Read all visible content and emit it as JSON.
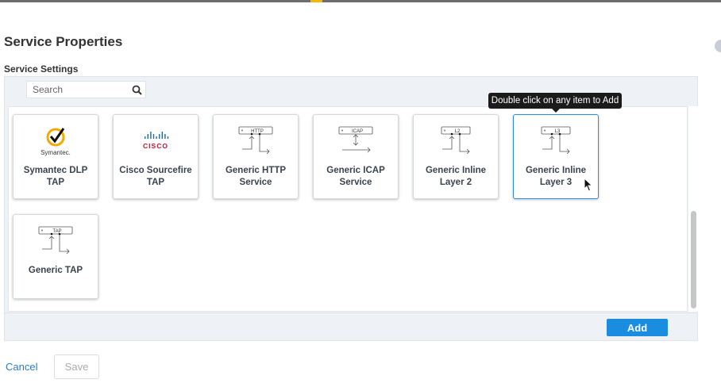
{
  "page": {
    "title": "Service Properties",
    "section": "Service Settings"
  },
  "search": {
    "placeholder": "Search"
  },
  "tooltip": "Double click on any item to Add",
  "items": [
    {
      "label1": "Symantec DLP",
      "label2": "TAP",
      "icon": "symantec-logo",
      "logo_text": "Symantec."
    },
    {
      "label1": "Cisco Sourcefire",
      "label2": "TAP",
      "icon": "cisco-logo",
      "logo_text": "CISCO"
    },
    {
      "label1": "Generic HTTP",
      "label2": "Service",
      "icon": "http-diagram",
      "tag": "HTTP"
    },
    {
      "label1": "Generic ICAP",
      "label2": "Service",
      "icon": "icap-diagram",
      "tag": "ICAP"
    },
    {
      "label1": "Generic Inline",
      "label2": "Layer 2",
      "icon": "l2-diagram",
      "tag": "L2"
    },
    {
      "label1": "Generic Inline",
      "label2": "Layer 3",
      "icon": "l3-diagram",
      "tag": "L3",
      "selected": true
    },
    {
      "label1": "Generic TAP",
      "label2": "",
      "icon": "tap-diagram",
      "tag": "TAP"
    }
  ],
  "footer": {
    "add": "Add"
  },
  "actions": {
    "cancel": "Cancel",
    "save": "Save"
  },
  "colors": {
    "accent": "#1a8de0",
    "selected_border": "#2a8de6",
    "panel": "#eef2f7"
  }
}
